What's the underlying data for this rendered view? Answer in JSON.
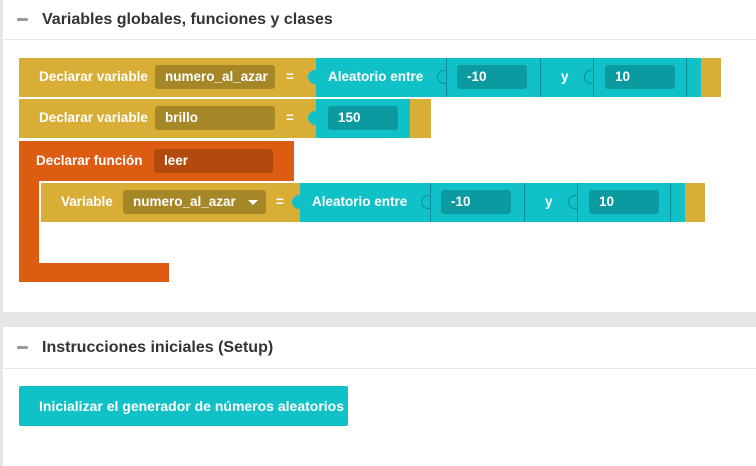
{
  "sections": {
    "globals": {
      "title": "Variables globales, funciones y clases",
      "blocks": {
        "var1": {
          "keyword": "Declarar variable",
          "name": "numero_al_azar",
          "assign": "=",
          "random_label": "Aleatorio entre",
          "min": "-10",
          "between": "y",
          "max": "10"
        },
        "var2": {
          "keyword": "Declarar variable",
          "name": "brillo",
          "assign": "=",
          "value": "150"
        },
        "func": {
          "keyword": "Declarar función",
          "name": "leer",
          "body": {
            "keyword": "Variable",
            "selected": "numero_al_azar",
            "assign": "=",
            "random_label": "Aleatorio entre",
            "min": "-10",
            "between": "y",
            "max": "10"
          }
        }
      }
    },
    "setup": {
      "title": "Instrucciones iniciales (Setup)",
      "button_label": "Inicializar el generador de números aleatorios"
    }
  },
  "colors": {
    "variable_block": "#d9ae36",
    "function_block": "#de5c12",
    "math_block": "#11c1c8",
    "page_background": "#e6e6e6"
  }
}
